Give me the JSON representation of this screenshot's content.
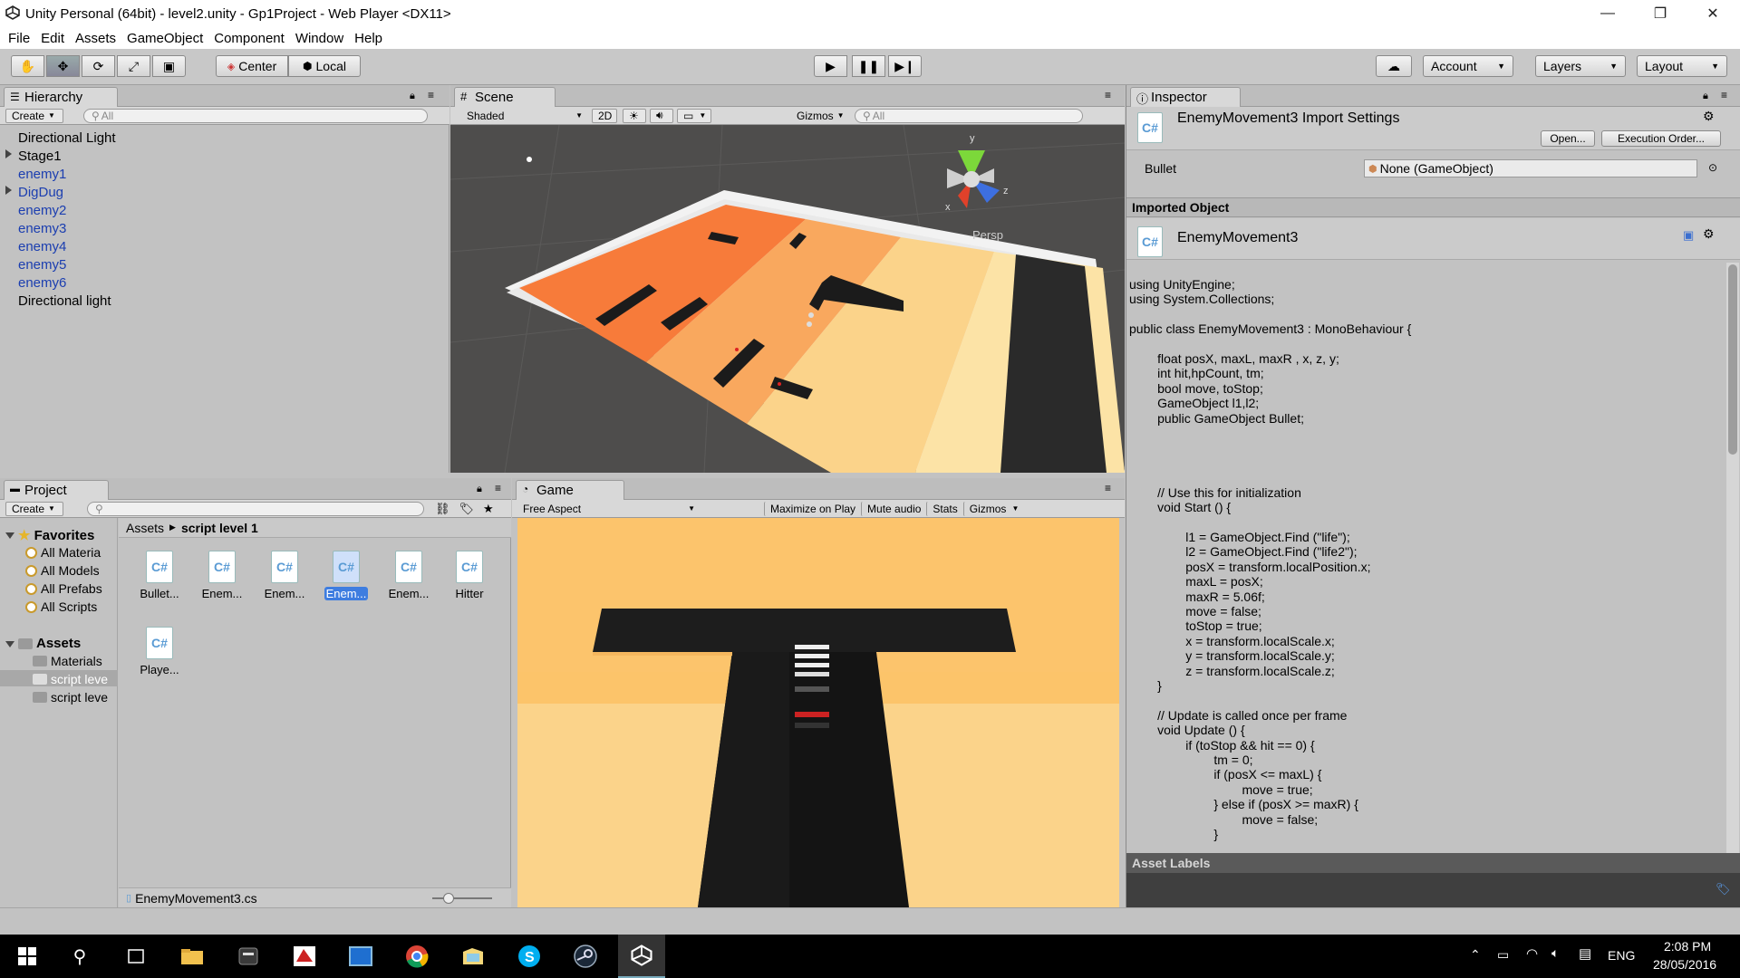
{
  "window": {
    "title": "Unity Personal (64bit) - level2.unity - Gp1Project - Web Player <DX11>",
    "minimize": "—",
    "maximize": "❐",
    "close": "✕"
  },
  "menu": [
    "File",
    "Edit",
    "Assets",
    "GameObject",
    "Component",
    "Window",
    "Help"
  ],
  "toolbar": {
    "center": "Center",
    "local": "Local",
    "account": "Account",
    "layers": "Layers",
    "layout": "Layout"
  },
  "hierarchy": {
    "tab": "Hierarchy",
    "create": "Create",
    "search_placeholder": "All",
    "items": [
      {
        "label": "Directional Light",
        "prefab": false,
        "expandable": false
      },
      {
        "label": "Stage1",
        "prefab": false,
        "expandable": true
      },
      {
        "label": "enemy1",
        "prefab": true,
        "expandable": false
      },
      {
        "label": "DigDug",
        "prefab": true,
        "expandable": true
      },
      {
        "label": "enemy2",
        "prefab": true,
        "expandable": false
      },
      {
        "label": "enemy3",
        "prefab": true,
        "expandable": false
      },
      {
        "label": "enemy4",
        "prefab": true,
        "expandable": false
      },
      {
        "label": "enemy5",
        "prefab": true,
        "expandable": false
      },
      {
        "label": "enemy6",
        "prefab": true,
        "expandable": false
      },
      {
        "label": "Directional light",
        "prefab": false,
        "expandable": false
      }
    ]
  },
  "scene": {
    "tab": "Scene",
    "shading": "Shaded",
    "mode_2d": "2D",
    "gizmos": "Gizmos",
    "search_placeholder": "All",
    "persp": "Persp",
    "axis_y": "y",
    "axis_x": "x",
    "axis_z": "z"
  },
  "inspector": {
    "tab": "Inspector",
    "title": "EnemyMovement3 Import Settings",
    "open": "Open...",
    "execution_order": "Execution Order...",
    "field_label": "Bullet",
    "field_value": "None (GameObject)",
    "imported_object": "Imported Object",
    "object_name": "EnemyMovement3",
    "asset_labels": "Asset Labels",
    "code": "using UnityEngine;\nusing System.Collections;\n\npublic class EnemyMovement3 : MonoBehaviour {\n\n\t\tfloat posX, maxL, maxR , x, z, y;\n\t\tint hit,hpCount, tm;\n\t\tbool move, toStop;\n\t\tGameObject l1,l2;\n\t\tpublic GameObject Bullet;\n\n\n\n\n\t\t// Use this for initialization\n\t\tvoid Start () {\n\n\t\t\t\tl1 = GameObject.Find (\"life\");\n\t\t\t\tl2 = GameObject.Find (\"life2\");\n\t\t\t\tposX = transform.localPosition.x;\n\t\t\t\tmaxL = posX;\n\t\t\t\tmaxR = 5.06f;\n\t\t\t\tmove = false;\n\t\t\t\ttoStop = true;\n\t\t\t\tx = transform.localScale.x;\n\t\t\t\ty = transform.localScale.y;\n\t\t\t\tz = transform.localScale.z;\n\t\t}\n\n\t\t// Update is called once per frame\n\t\tvoid Update () {\n\t\t\t\tif (toStop && hit == 0) {\n\t\t\t\t\t\ttm = 0;\n\t\t\t\t\t\tif (posX <= maxL) {\n\t\t\t\t\t\t\t\tmove = true;\n\t\t\t\t\t\t} else if (posX >= maxR) {\n\t\t\t\t\t\t\t\tmove = false;\n\t\t\t\t\t\t}\n\n\t\t\t\t\t\tif (move) {"
  },
  "project": {
    "tab": "Project",
    "create": "Create",
    "favorites": "Favorites",
    "fav_items": [
      "All Materia",
      "All Models",
      "All Prefabs",
      "All Scripts"
    ],
    "assets": "Assets",
    "asset_folders": [
      "Materials",
      "script leve",
      "script leve"
    ],
    "breadcrumb_root": "Assets",
    "breadcrumb_current": "script level 1",
    "files": [
      {
        "label": "Bullet...",
        "selected": false
      },
      {
        "label": "Enem...",
        "selected": false
      },
      {
        "label": "Enem...",
        "selected": false
      },
      {
        "label": "Enem...",
        "selected": true
      },
      {
        "label": "Enem...",
        "selected": false
      },
      {
        "label": "Hitter",
        "selected": false
      },
      {
        "label": "Playe...",
        "selected": false
      }
    ],
    "footer_file": "EnemyMovement3.cs"
  },
  "game": {
    "tab": "Game",
    "aspect": "Free Aspect",
    "maximize": "Maximize on Play",
    "mute": "Mute audio",
    "stats": "Stats",
    "gizmos": "Gizmos"
  },
  "taskbar": {
    "language": "ENG",
    "time": "2:08 PM",
    "date": "28/05/2016"
  },
  "colors": {
    "accent": "#3e7de0",
    "prefab_text": "#1b3eb0",
    "floor_orange": "#f77b3a",
    "floor_light": "#fbd38a"
  }
}
